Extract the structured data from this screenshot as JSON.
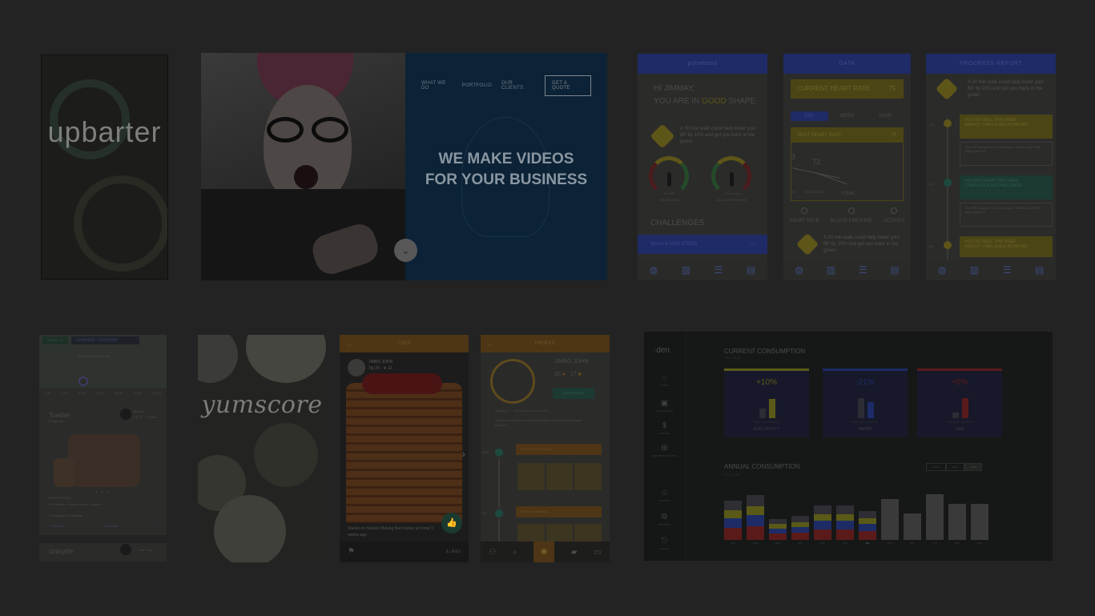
{
  "upbarter": {
    "logo": "upbarter"
  },
  "video": {
    "nav": [
      "WHAT WE DO",
      "PORTFOLIO",
      "OUR CLIENTS"
    ],
    "quote_button": "GET A QUOTE",
    "headline_line1": "WE MAKE VIDEOS",
    "headline_line2": "FOR YOUR BUSINESS",
    "scroll_icon": "chevron-down-icon"
  },
  "pulse": {
    "title": "pulseband",
    "greeting_line1": "HI JIMMAY,",
    "greeting_prefix": "YOU ARE IN",
    "greeting_highlight": "GOOD",
    "greeting_suffix": "SHAPE",
    "tip": "A 30 min walk could help lower your BP by 10% and get you back in the green.",
    "gauge1_value": "60 BMP",
    "gauge1_label": "HEART RATE",
    "gauge2_value": "120 mmHg",
    "gauge2_label": "BLOOD PRESSURE",
    "challenges": "CHALLENGES",
    "challenge_item": "WALK A 1000 STEPS",
    "challenge_toggle": "—"
  },
  "data_screen": {
    "title": "DATA",
    "current_rate_label": "CURRENT HEART RATE",
    "current_rate_value": "75",
    "tabs": [
      "DAY",
      "WEEK",
      "YEAR"
    ],
    "box_header": "PAST HEART RATE",
    "box_value": "75",
    "val_left": "3",
    "val_mid": "72",
    "label_yesterday": "YESTERDAY",
    "label_today": "TODAY",
    "label_left": "20",
    "radios": [
      "HEART RATE",
      "BLOOD PRESURE",
      "ACTIVITY"
    ],
    "tip": "A 30 min walk could help lower your BP by 10% and get you back in the green."
  },
  "progress": {
    "title": "PROGRESS REPORT",
    "tip": "A 30 min walk could help lower your BP by 10% and get you back in the green.",
    "dates": [
      "7/6",
      "6/1",
      "6/6"
    ],
    "card1_title": "YOU DID WELL THIS WEEK",
    "card1_sub": "WEEKLY CHALLENGE ACHIEVED",
    "card1_detail": "Your BP dropped by 2% this week. Reach more 3000 steps goal left.",
    "card2_title": "YOU DID GREAT THIS WEEK",
    "card2_sub": "COMPLETED 5/5 CHALLENGE",
    "card2_detail": "Your BP dropped by 2% this week. Raise more 3000 steps goal left.",
    "card3_title": "YOU DID WELL THIS WEEK",
    "card3_sub": "WEEKLY CHALLENGE ACHIEVED"
  },
  "market": {
    "checkin": "CHECK IN",
    "location": "CURRENT LOCATION",
    "radius": "10 miles radius (10 mi)",
    "scale": [
      "1 mi",
      "5 mi",
      "10 mi",
      "25 mi",
      "50 mi",
      "75 mi",
      "100 mi"
    ],
    "item_title": "Toaster",
    "item_age": "3 days ago",
    "seller": "Jimmay",
    "seller_stats": "4.6 / 5 · 1 review",
    "pager": "• • •",
    "desc_label": "DESCRIPTION",
    "desc_text": "Fun toaster. I make me cute 4 toasts!",
    "meta": "2 Reviews   3 Comments",
    "favorite": "Favorite",
    "comment": "Comment",
    "item2_title": "Unicycle",
    "seller2": "Rain Guy"
  },
  "yum": {
    "logo": "yumscore"
  },
  "pancake": {
    "title": "USER",
    "back_icon": "←",
    "user_name": "JIMBO JOHN",
    "user_meta": "Tip 20 · ★ 12",
    "caption": "Stacks on Stacks! Making that money at home 5 weeks ago",
    "likes": "8 LIKES",
    "like_icon": "👍",
    "next_icon": "›",
    "flag_icon": "⚑"
  },
  "profile": {
    "title": "PROFILE",
    "back_icon": "←",
    "name": "JIMBO JOHN",
    "stat1": "20",
    "stat2": "17",
    "edit": "EDIT PROFILE",
    "meta": "Chicago, IL · Member since Nov 2015",
    "bio": "A man on a mission to try every single taco from every single taqueria.",
    "dates": [
      "1/25",
      "2/6"
    ],
    "post1": "LITTLE TACO STAND",
    "post2": "STELLA FAMOSA"
  },
  "den": {
    "logo": "den",
    "nav": [
      {
        "icon": "⌂",
        "label": "HOME"
      },
      {
        "icon": "▣",
        "label": "CONSUMPTION"
      },
      {
        "icon": "$",
        "label": "BILLING"
      },
      {
        "icon": "⊞",
        "label": "RECOMMENDATIONS"
      },
      {
        "icon": "☺",
        "label": "PROFILE"
      },
      {
        "icon": "⚙",
        "label": "SETTINGS"
      },
      {
        "icon": "⎋",
        "label": "LOGOUT"
      }
    ],
    "current_title": "CURRENT CONSUMPTION",
    "current_sub": "THIS YEAR",
    "cards": [
      {
        "pct": "+10%",
        "name": "ELECTRICITY",
        "compare": "PREVIOUS  CURRENT",
        "color": "#5a5a18",
        "prev": 0.35,
        "cur": 0.7
      },
      {
        "pct": "-21%",
        "name": "WATER",
        "compare": "PREVIOUS  CURRENT",
        "color": "#1d2c66",
        "prev": 0.75,
        "cur": 0.6
      },
      {
        "pct": "+5%",
        "name": "GAS",
        "compare": "PREVIOUS  CURRENT",
        "color": "#5b1a1a",
        "prev": 0.2,
        "cur": 0.75
      }
    ],
    "annual_title": "ANNUAL CONSUMPTION",
    "annual_sub": "2014-2015",
    "range": [
      "MONTH",
      "WEEK",
      "YEAR"
    ],
    "months": [
      "JAN",
      "FEB",
      "MAR",
      "APR",
      "MAY",
      "JUN",
      "JUL",
      "AUG",
      "SEP",
      "OCT",
      "NOV",
      "DEC"
    ],
    "month_heights": [
      0.75,
      0.85,
      0.4,
      0.45,
      0.65,
      0.65,
      0.55,
      0.78,
      0.5,
      0.87,
      0.68,
      0.68
    ],
    "active_month": "JUL"
  }
}
